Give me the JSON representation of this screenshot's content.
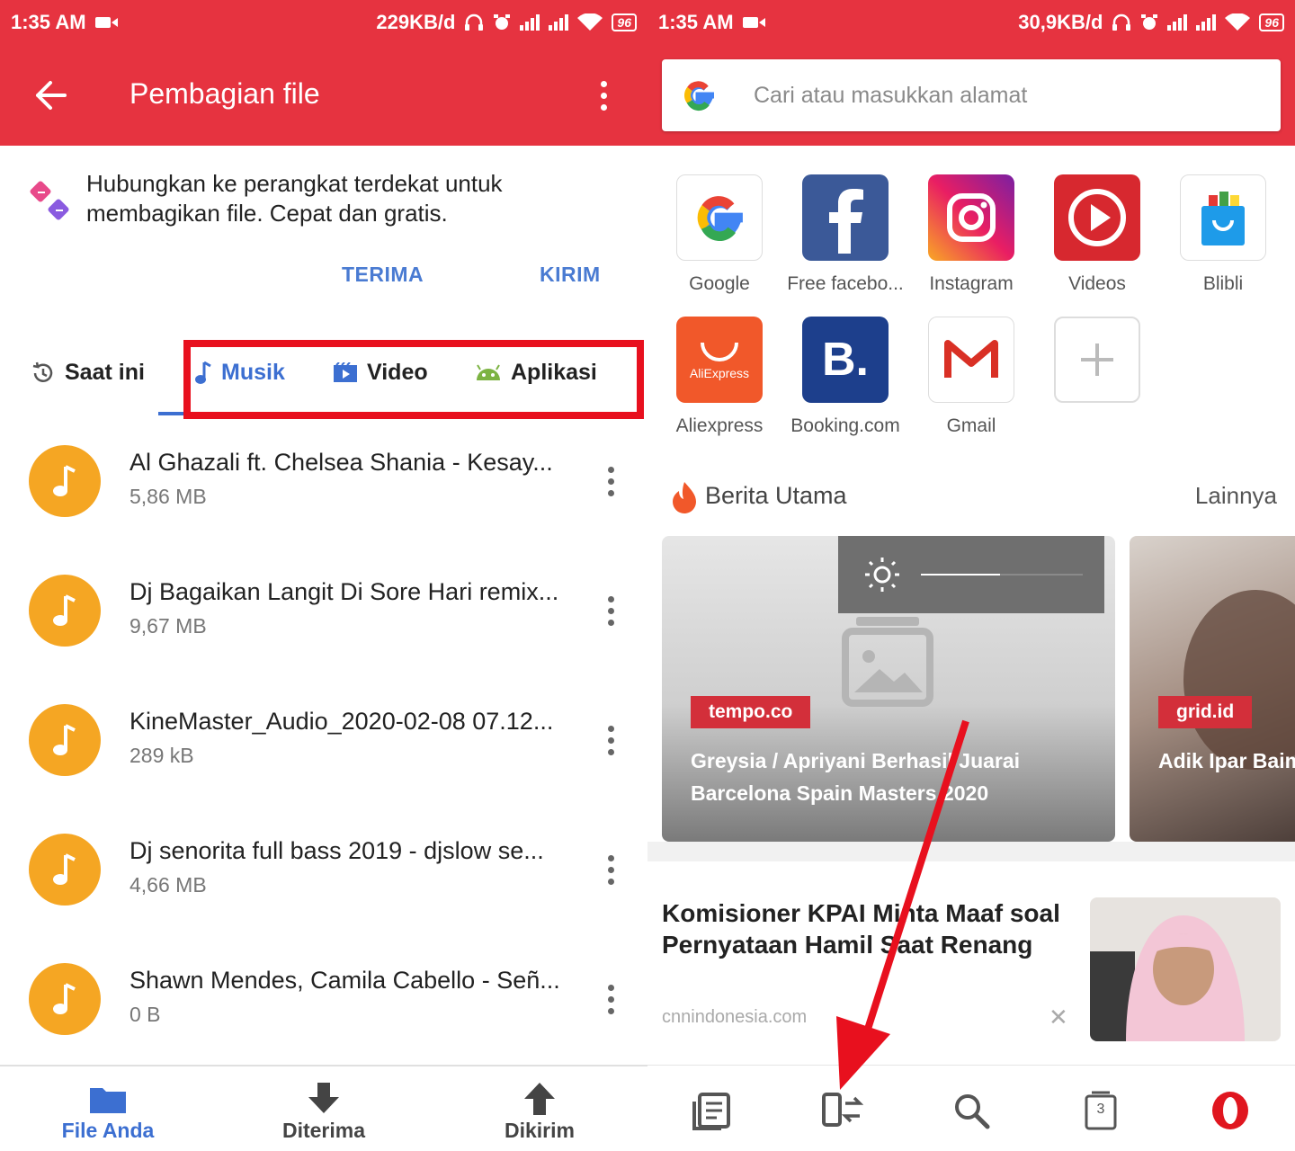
{
  "left": {
    "status": {
      "time": "1:35 AM",
      "speed": "229KB/d",
      "battery": "96"
    },
    "appbar": {
      "title": "Pembagian file"
    },
    "intro": {
      "text": "Hubungkan ke perangkat terdekat untuk membagikan file. Cepat dan gratis."
    },
    "actions": {
      "receive": "TERIMA",
      "send": "KIRIM"
    },
    "tabs": [
      {
        "label": "Saat ini",
        "icon": "history-icon"
      },
      {
        "label": "Musik",
        "icon": "music-note-icon"
      },
      {
        "label": "Video",
        "icon": "video-icon"
      },
      {
        "label": "Aplikasi",
        "icon": "android-icon"
      }
    ],
    "files": [
      {
        "name": "Al Ghazali ft. Chelsea Shania - Kesay...",
        "size": "5,86 MB"
      },
      {
        "name": "Dj Bagaikan Langit Di Sore Hari remix...",
        "size": "9,67 MB"
      },
      {
        "name": "KineMaster_Audio_2020-02-08 07.12...",
        "size": "289 kB"
      },
      {
        "name": "Dj senorita full bass 2019 - djslow se...",
        "size": "4,66 MB"
      },
      {
        "name": "Shawn Mendes, Camila Cabello - Señ...",
        "size": "0 B"
      }
    ],
    "nav": [
      {
        "label": "File Anda",
        "icon": "folder-icon"
      },
      {
        "label": "Diterima",
        "icon": "download-arrow-icon"
      },
      {
        "label": "Dikirim",
        "icon": "upload-arrow-icon"
      }
    ],
    "colors": {
      "accent": "#e63340",
      "link": "#3c6fd1",
      "music": "#f5a623"
    }
  },
  "right": {
    "status": {
      "time": "1:35 AM",
      "speed": "30,9KB/d",
      "battery": "96"
    },
    "search": {
      "placeholder": "Cari atau masukkan alamat"
    },
    "speed_dials": [
      {
        "label": "Google",
        "icon": "google-icon"
      },
      {
        "label": "Free facebo...",
        "icon": "facebook-icon"
      },
      {
        "label": "Instagram",
        "icon": "instagram-icon"
      },
      {
        "label": "Videos",
        "icon": "play-icon"
      },
      {
        "label": "Blibli",
        "icon": "blibli-icon"
      },
      {
        "label": "Aliexpress",
        "icon": "aliexpress-icon",
        "text": "AliExpress"
      },
      {
        "label": "Booking.com",
        "icon": "booking-icon",
        "text": "B."
      },
      {
        "label": "Gmail",
        "icon": "gmail-icon"
      },
      {
        "label": "",
        "icon": "plus-icon"
      }
    ],
    "news": {
      "title": "Berita Utama",
      "more": "Lainnya",
      "cards": [
        {
          "source": "tempo.co",
          "title": "Greysia / Apriyani Berhasil Juarai Barcelona Spain Masters 2020"
        },
        {
          "source": "grid.id",
          "title": "Adik Ipar Baim Pria yang Tak"
        }
      ]
    },
    "article": {
      "title": "Komisioner KPAI Minta Maaf soal Pernyataan Hamil Saat Renang",
      "source": "cnnindonesia.com",
      "close": "✕"
    },
    "nav": [
      {
        "icon": "news-icon"
      },
      {
        "icon": "file-share-icon"
      },
      {
        "icon": "search-icon"
      },
      {
        "icon": "tabs-icon",
        "count": "3"
      },
      {
        "icon": "opera-icon"
      }
    ]
  }
}
